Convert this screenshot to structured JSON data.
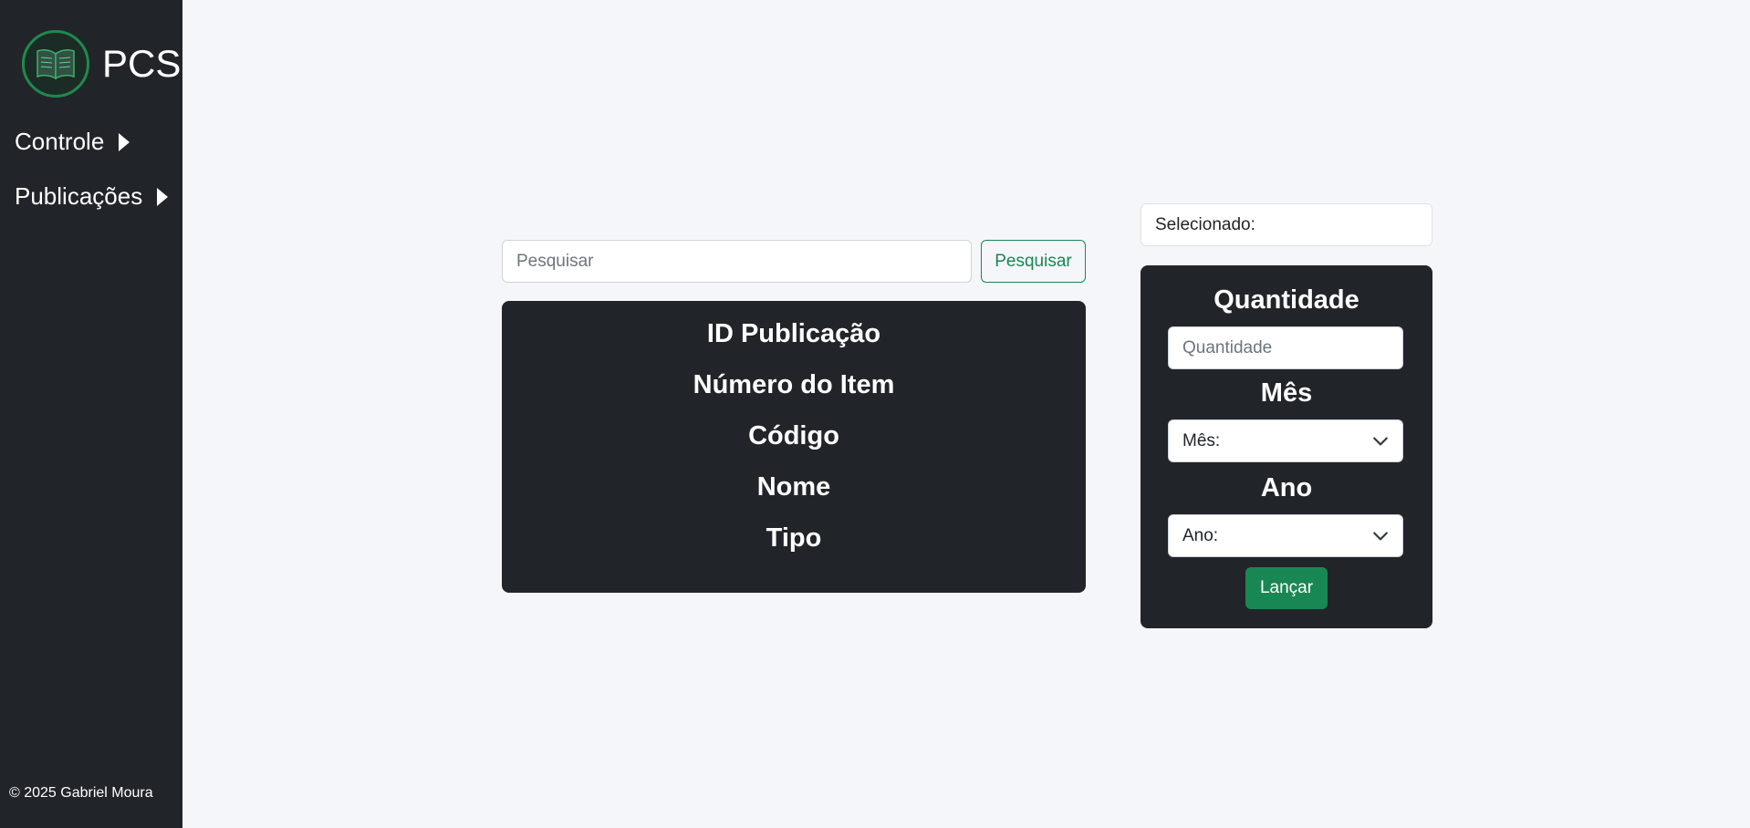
{
  "sidebar": {
    "brand": "PCS",
    "nav": [
      {
        "label": "Controle"
      },
      {
        "label": "Publicações"
      }
    ],
    "footer": "© 2025 Gabriel Moura"
  },
  "search": {
    "placeholder": "Pesquisar",
    "button_label": "Pesquisar"
  },
  "table": {
    "headers": [
      "ID Publicação",
      "Número do Item",
      "Código",
      "Nome",
      "Tipo"
    ]
  },
  "form": {
    "selected_label": "Selecionado:",
    "quantity_label": "Quantidade",
    "quantity_placeholder": "Quantidade",
    "month_label": "Mês",
    "month_value": "Mês:",
    "year_label": "Ano",
    "year_value": "Ano:",
    "submit_label": "Lançar"
  },
  "colors": {
    "sidebar_bg": "#212529",
    "card_bg": "#212529",
    "accent_green": "#198754",
    "page_bg": "#f5f6fa"
  }
}
